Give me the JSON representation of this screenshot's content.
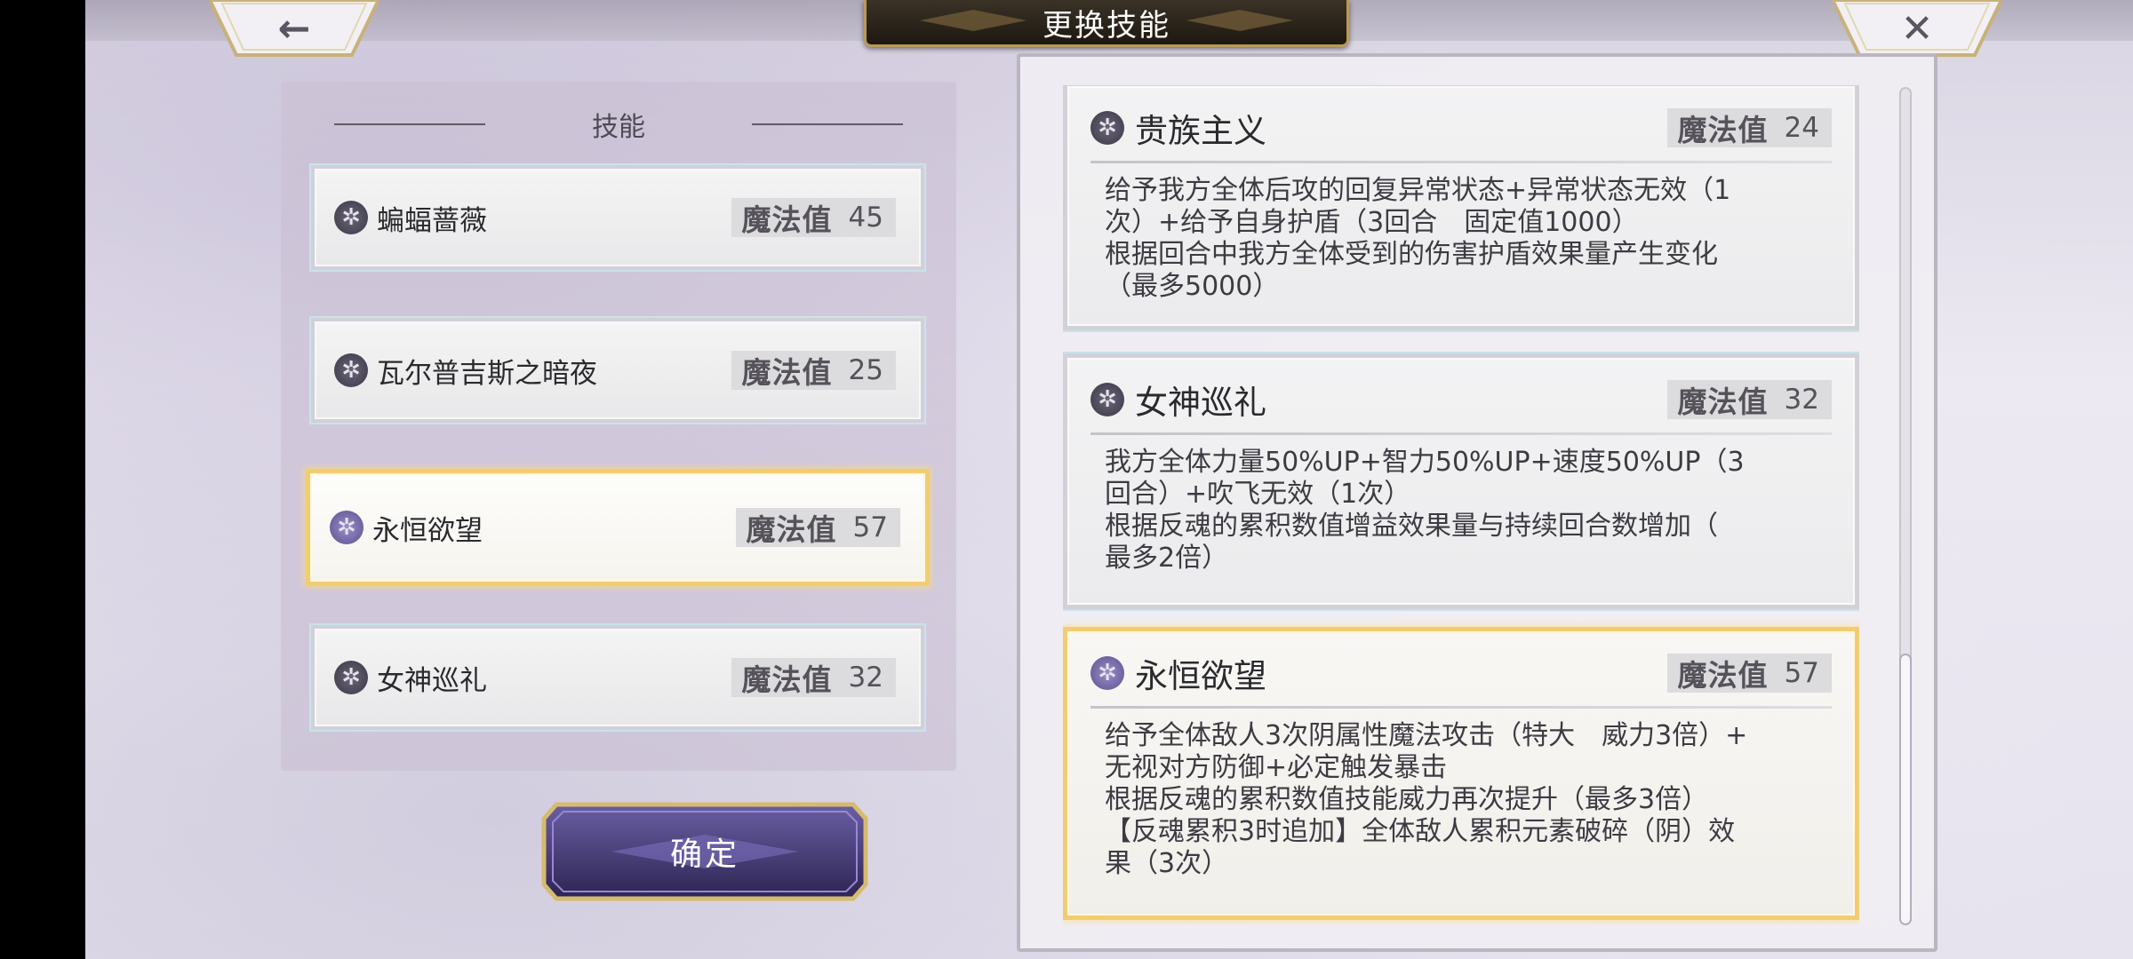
{
  "header": {
    "title": "更换技能",
    "back_icon": "arrow-left-icon",
    "close_icon": "close-icon"
  },
  "skill_list": {
    "title": "技能",
    "mp_label": "魔法值",
    "selected_index": 2,
    "items": [
      {
        "name": "蝙蝠蔷薇",
        "mp": "45",
        "icon": "skill-emblem-icon"
      },
      {
        "name": "瓦尔普吉斯之暗夜",
        "mp": "25",
        "icon": "skill-emblem-icon"
      },
      {
        "name": "永恒欲望",
        "mp": "57",
        "icon": "skill-emblem-icon"
      },
      {
        "name": "女神巡礼",
        "mp": "32",
        "icon": "skill-emblem-icon"
      }
    ]
  },
  "confirm": {
    "label": "确定"
  },
  "details": {
    "mp_label": "魔法值",
    "cards": [
      {
        "name": "贵族主义",
        "mp": "24",
        "description": "给予我方全体后攻的回复异常状态+异常状态无效（1\n次）+给予自身护盾（3回合　固定值1000）\n根据回合中我方全体受到的伤害护盾效果量产生变化\n（最多5000）"
      },
      {
        "name": "女神巡礼",
        "mp": "32",
        "description": "我方全体力量50%UP+智力50%UP+速度50%UP（3\n回合）+吹飞无效（1次）\n根据反魂的累积数值增益效果量与持续回合数增加（\n最多2倍）"
      },
      {
        "name": "永恒欲望",
        "mp": "57",
        "description": "给予全体敌人3次阴属性魔法攻击（特大　威力3倍）+\n无视对方防御+必定触发暴击\n根据反魂的累积数值技能威力再次提升（最多3倍）\n【反魂累积3时追加】全体敌人累积元素破碎（阴）效\n果（3次）"
      }
    ]
  },
  "colors": {
    "selected_border": "#f1cd72",
    "normal_border": "#d3d1d8",
    "confirm_button": "#4a3f7a"
  }
}
